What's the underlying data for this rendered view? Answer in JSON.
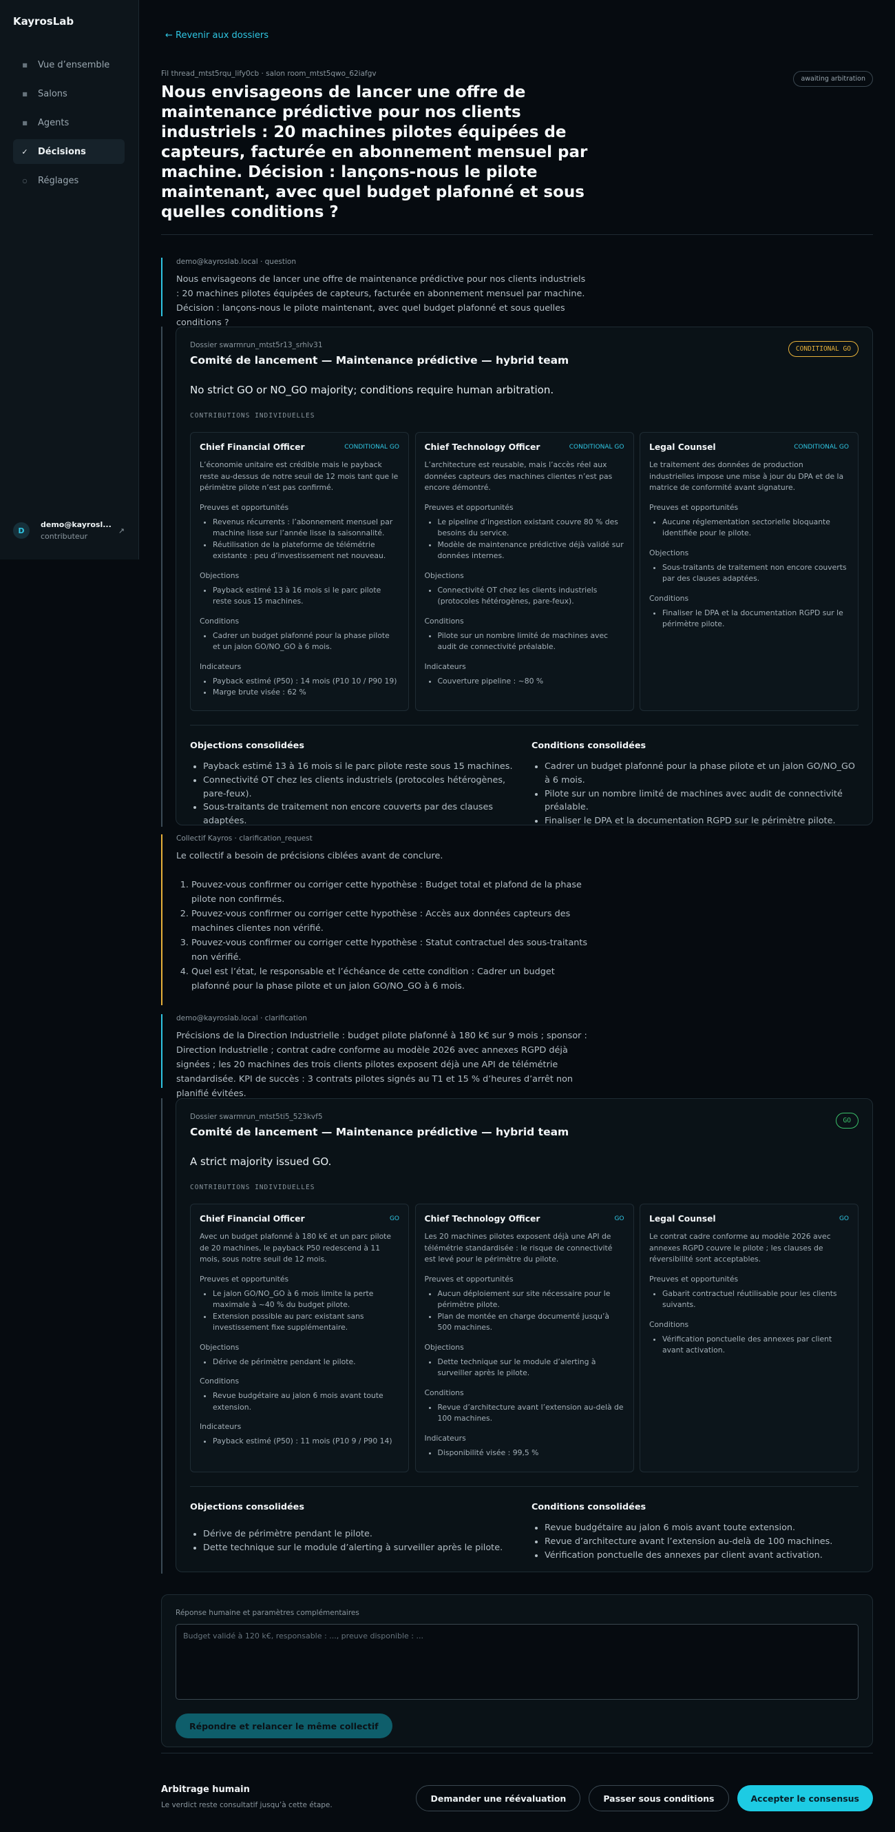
{
  "app": {
    "name": "KayrosLab"
  },
  "nav": {
    "items": [
      {
        "label": "Vue d’ensemble",
        "icon": "square-bullet-icon"
      },
      {
        "label": "Salons",
        "icon": "square-bullet-icon"
      },
      {
        "label": "Agents",
        "icon": "square-bullet-icon"
      },
      {
        "label": "Décisions",
        "icon": "check-icon",
        "active": true
      },
      {
        "label": "Réglages",
        "icon": "circle-icon"
      }
    ]
  },
  "user": {
    "initial": "D",
    "email": "demo@kayrosl...",
    "role": "contributeur"
  },
  "header": {
    "back": "← Revenir aux dossiers",
    "thread_meta": "Fil thread_mtst5rqu_lify0cb · salon room_mtst5qwo_62iafgv",
    "status": "awaiting arbitration",
    "title": "Nous envisageons de lancer une offre de maintenance prédictive pour nos clients industriels : 20 machines pilotes équipées de capteurs, facturée en abonnement mensuel par machine. Décision : lançons-nous le pilote maintenant, avec quel budget plafonné et sous quelles conditions ?"
  },
  "messages": {
    "question": {
      "meta": "demo@kayroslab.local · question",
      "text": "Nous envisageons de lancer une offre de maintenance prédictive pour nos clients industriels : 20 machines pilotes équipées de capteurs, facturée en abonnement mensuel par machine. Décision : lançons-nous le pilote maintenant, avec quel budget plafonné et sous quelles conditions ?"
    },
    "clarification_request": {
      "meta": "Collectif Kayros · clarification_request",
      "text": "Le collectif a besoin de précisions ciblées avant de conclure.",
      "items": [
        "Pouvez-vous confirmer ou corriger cette hypothèse : Budget total et plafond de la phase pilote non confirmés.",
        "Pouvez-vous confirmer ou corriger cette hypothèse : Accès aux données capteurs des machines clientes non vérifié.",
        "Pouvez-vous confirmer ou corriger cette hypothèse : Statut contractuel des sous-traitants non vérifié.",
        "Quel est l’état, le responsable et l’échéance de cette condition : Cadrer un budget plafonné pour la phase pilote et un jalon GO/NO_GO à 6 mois."
      ]
    },
    "clarification": {
      "meta": "demo@kayroslab.local · clarification",
      "text": "Précisions de la Direction Industrielle : budget pilote plafonné à 180 k€ sur 9 mois ; sponsor : Direction Industrielle ; contrat cadre conforme au modèle 2026 avec annexes RGPD déjà signées ; les 20 machines des trois clients pilotes exposent déjà une API de télémétrie standardisée. KPI de succès : 3 contrats pilotes signés au T1 et 15 % d’heures d’arrêt non planifié évitées."
    }
  },
  "dossiers": [
    {
      "id": "Dossier swarmrun_mtst5r13_srhlv31",
      "title": "Comité de lancement — Maintenance prédictive — hybrid team",
      "verdict": "CONDITIONAL GO",
      "summary": "No strict GO or NO_GO majority; conditions require human arbitration.",
      "contrib_label": "CONTRIBUTIONS INDIVIDUELLES",
      "contributions": [
        {
          "role": "Chief Financial Officer",
          "verdict": "CONDITIONAL GO",
          "text": "L’économie unitaire est crédible mais le payback reste au-dessus de notre seuil de 12 mois tant que le périmètre pilote n’est pas confirmé.",
          "sections": [
            {
              "label": "Preuves et opportunités",
              "items": [
                "Revenus récurrents : l’abonnement mensuel par machine lisse sur l’année lisse la saisonnalité.",
                "Réutilisation de la plateforme de télémétrie existante : peu d’investissement net nouveau."
              ]
            },
            {
              "label": "Objections",
              "items": [
                "Payback estimé 13 à 16 mois si le parc pilote reste sous 15 machines."
              ]
            },
            {
              "label": "Conditions",
              "items": [
                "Cadrer un budget plafonné pour la phase pilote et un jalon GO/NO_GO à 6 mois."
              ]
            },
            {
              "label": "Indicateurs",
              "items": [
                "Payback estimé (P50) : 14 mois (P10 10 / P90 19)",
                "Marge brute visée : 62 %"
              ]
            }
          ]
        },
        {
          "role": "Chief Technology Officer",
          "verdict": "CONDITIONAL GO",
          "text": "L’architecture est reusable, mais l’accès réel aux données capteurs des machines clientes n’est pas encore démontré.",
          "sections": [
            {
              "label": "Preuves et opportunités",
              "items": [
                "Le pipeline d’ingestion existant couvre 80 % des besoins du service.",
                "Modèle de maintenance prédictive déjà validé sur données internes."
              ]
            },
            {
              "label": "Objections",
              "items": [
                "Connectivité OT chez les clients industriels (protocoles hétérogènes, pare-feux)."
              ]
            },
            {
              "label": "Conditions",
              "items": [
                "Pilote sur un nombre limité de machines avec audit de connectivité préalable."
              ]
            },
            {
              "label": "Indicateurs",
              "items": [
                "Couverture pipeline : ~80 %"
              ]
            }
          ]
        },
        {
          "role": "Legal Counsel",
          "verdict": "CONDITIONAL GO",
          "text": "Le traitement des données de production industrielles impose une mise à jour du DPA et de la matrice de conformité avant signature.",
          "sections": [
            {
              "label": "Preuves et opportunités",
              "items": [
                "Aucune réglementation sectorielle bloquante identifiée pour le pilote."
              ]
            },
            {
              "label": "Objections",
              "items": [
                "Sous-traitants de traitement non encore couverts par des clauses adaptées."
              ]
            },
            {
              "label": "Conditions",
              "items": [
                "Finaliser le DPA et la documentation RGPD sur le périmètre pilote."
              ]
            }
          ]
        }
      ],
      "objections_title": "Objections consolidées",
      "objections": [
        "Payback estimé 13 à 16 mois si le parc pilote reste sous 15 machines.",
        "Connectivité OT chez les clients industriels (protocoles hétérogènes, pare-feux).",
        "Sous-traitants de traitement non encore couverts par des clauses adaptées."
      ],
      "conditions_title": "Conditions consolidées",
      "conditions": [
        "Cadrer un budget plafonné pour la phase pilote et un jalon GO/NO_GO à 6 mois.",
        "Pilote sur un nombre limité de machines avec audit de connectivité préalable.",
        "Finaliser le DPA et la documentation RGPD sur le périmètre pilote."
      ]
    },
    {
      "id": "Dossier swarmrun_mtst5ti5_523kvf5",
      "title": "Comité de lancement — Maintenance prédictive — hybrid team",
      "verdict": "GO",
      "summary": "A strict majority issued GO.",
      "contrib_label": "CONTRIBUTIONS INDIVIDUELLES",
      "contributions": [
        {
          "role": "Chief Financial Officer",
          "verdict": "GO",
          "text": "Avec un budget plafonné à 180 k€ et un parc pilote de 20 machines, le payback P50 redescend à 11 mois, sous notre seuil de 12 mois.",
          "sections": [
            {
              "label": "Preuves et opportunités",
              "items": [
                "Le jalon GO/NO_GO à 6 mois limite la perte maximale à ~40 % du budget pilote.",
                "Extension possible au parc existant sans investissement fixe supplémentaire."
              ]
            },
            {
              "label": "Objections",
              "items": [
                "Dérive de périmètre pendant le pilote."
              ]
            },
            {
              "label": "Conditions",
              "items": [
                "Revue budgétaire au jalon 6 mois avant toute extension."
              ]
            },
            {
              "label": "Indicateurs",
              "items": [
                "Payback estimé (P50) : 11 mois (P10 9 / P90 14)"
              ]
            }
          ]
        },
        {
          "role": "Chief Technology Officer",
          "verdict": "GO",
          "text": "Les 20 machines pilotes exposent déjà une API de télémétrie standardisée : le risque de connectivité est levé pour le périmètre du pilote.",
          "sections": [
            {
              "label": "Preuves et opportunités",
              "items": [
                "Aucun déploiement sur site nécessaire pour le périmètre pilote.",
                "Plan de montée en charge documenté jusqu’à 500 machines."
              ]
            },
            {
              "label": "Objections",
              "items": [
                "Dette technique sur le module d’alerting à surveiller après le pilote."
              ]
            },
            {
              "label": "Conditions",
              "items": [
                "Revue d’architecture avant l’extension au-delà de 100 machines."
              ]
            },
            {
              "label": "Indicateurs",
              "items": [
                "Disponibilité visée : 99,5 %"
              ]
            }
          ]
        },
        {
          "role": "Legal Counsel",
          "verdict": "GO",
          "text": "Le contrat cadre conforme au modèle 2026 avec annexes RGPD couvre le pilote ; les clauses de réversibilité sont acceptables.",
          "sections": [
            {
              "label": "Preuves et opportunités",
              "items": [
                "Gabarit contractuel réutilisable pour les clients suivants."
              ]
            },
            {
              "label": "Conditions",
              "items": [
                "Vérification ponctuelle des annexes par client avant activation."
              ]
            }
          ]
        }
      ],
      "objections_title": "Objections consolidées",
      "objections": [
        "Dérive de périmètre pendant le pilote.",
        "Dette technique sur le module d’alerting à surveiller après le pilote."
      ],
      "conditions_title": "Conditions consolidées",
      "conditions": [
        "Revue budgétaire au jalon 6 mois avant toute extension.",
        "Revue d’architecture avant l’extension au-delà de 100 machines.",
        "Vérification ponctuelle des annexes par client avant activation."
      ]
    }
  ],
  "reply": {
    "label": "Réponse humaine et paramètres complémentaires",
    "placeholder": "Budget validé à 120 k€, responsable : ..., preuve disponible : ...",
    "value": "",
    "button": "Répondre et relancer le même collectif"
  },
  "arbitration": {
    "title": "Arbitrage humain",
    "subtitle": "Le verdict reste consultatif jusqu’à cette étape.",
    "buttons": {
      "reevaluate": "Demander une réévaluation",
      "skip_conditions": "Passer sous conditions",
      "accept": "Accepter le consensus"
    }
  },
  "colors": {
    "accent": "#2fc6e3",
    "conditional": "#e7b13a",
    "go": "#3bc06a",
    "background": "#060b10"
  }
}
